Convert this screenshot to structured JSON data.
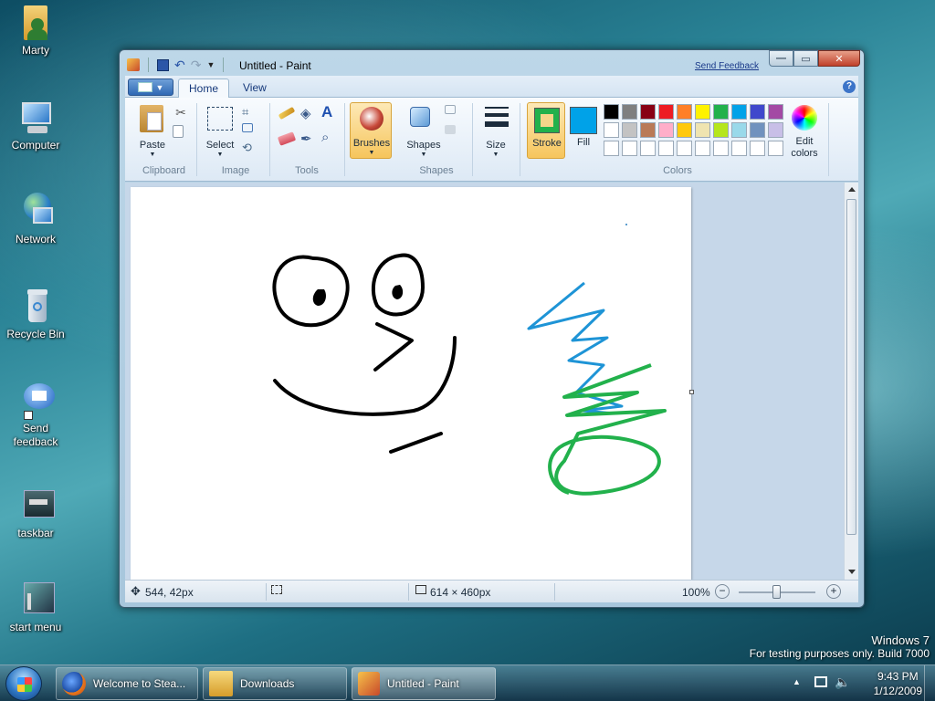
{
  "desktop": {
    "icons": [
      {
        "label": "Marty"
      },
      {
        "label": "Computer"
      },
      {
        "label": "Network"
      },
      {
        "label": "Recycle Bin"
      },
      {
        "label": "Send feedback"
      },
      {
        "label": "taskbar"
      },
      {
        "label": "start menu"
      }
    ],
    "watermark_line1": "Windows  7",
    "watermark_line2": "For testing purposes only. Build 7000"
  },
  "window": {
    "title": "Untitled - Paint",
    "feedback_link": "Send Feedback",
    "tabs": [
      {
        "label": "Home"
      },
      {
        "label": "View"
      }
    ],
    "ribbon": {
      "clipboard": {
        "paste": "Paste",
        "group": "Clipboard"
      },
      "image": {
        "select": "Select",
        "group": "Image"
      },
      "tools": {
        "group": "Tools"
      },
      "brushes": "Brushes",
      "shapes": {
        "label": "Shapes",
        "group": "Shapes"
      },
      "size": "Size",
      "stroke": "Stroke",
      "fill": "Fill",
      "colors_group": "Colors",
      "edit_colors_1": "Edit",
      "edit_colors_2": "colors",
      "palette_row1": [
        "#000000",
        "#7f7f7f",
        "#880015",
        "#ed1c24",
        "#ff7f27",
        "#fff200",
        "#22b14c",
        "#00a2e8",
        "#3f48cc",
        "#a349a4"
      ],
      "palette_row2": [
        "#ffffff",
        "#c3c3c3",
        "#b97a57",
        "#ffaec9",
        "#ffc90e",
        "#efe4b0",
        "#b5e61d",
        "#99d9ea",
        "#7092be",
        "#c8bfe7"
      ],
      "stroke_color": "#22b14c",
      "fill_color": "#00a2e8"
    },
    "status": {
      "cursor": "544, 42px",
      "canvas_size": "614 × 460px",
      "zoom": "100%"
    }
  },
  "taskbar": {
    "tasks": [
      {
        "label": "Welcome to Stea..."
      },
      {
        "label": "Downloads"
      },
      {
        "label": "Untitled - Paint"
      }
    ],
    "time": "9:43 PM",
    "date": "1/12/2009"
  }
}
